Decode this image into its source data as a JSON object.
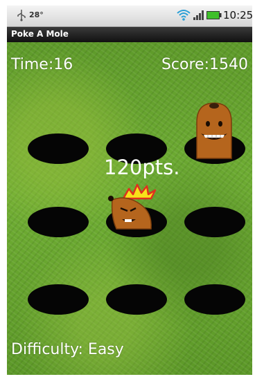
{
  "status_bar": {
    "temperature": "28°",
    "time": "10:25"
  },
  "app": {
    "title": "Poke A Mole"
  },
  "hud": {
    "time": "Time:16",
    "score": "Score:1540",
    "points_popup": "120pts.",
    "difficulty": "Difficulty: Easy"
  },
  "grid": {
    "rows": 3,
    "cols": 3,
    "moles": [
      {
        "cell": "row1-col3",
        "state": "up"
      },
      {
        "cell": "row2-col2",
        "state": "hit"
      }
    ]
  },
  "colors": {
    "grass": "#6fae33",
    "hole": "#050505",
    "mole": "#b5651d",
    "title_bar": "#111111"
  }
}
